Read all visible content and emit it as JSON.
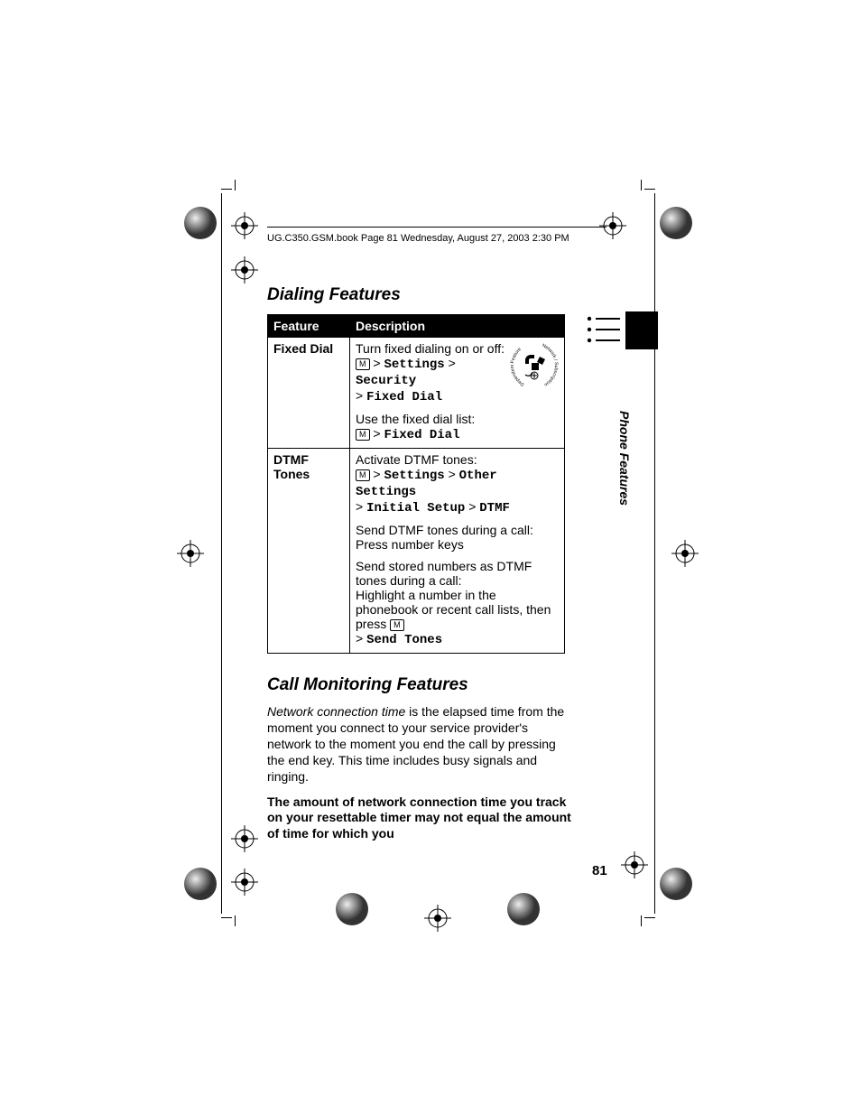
{
  "header": {
    "running": "UG.C350.GSM.book  Page 81  Wednesday, August 27, 2003  2:30 PM"
  },
  "section1": {
    "heading": "Dialing Features",
    "columns": {
      "feature": "Feature",
      "description": "Description"
    },
    "rows": {
      "fixed": {
        "name": "Fixed Dial",
        "p1": "Turn fixed dialing on or off:",
        "path1a": "Settings",
        "path1b": "Security",
        "path1c": "Fixed Dial",
        "p2": "Use the fixed dial list:",
        "path2a": "Fixed Dial",
        "icon_label": "Network / Subscription Dependent Feature"
      },
      "dtmf": {
        "name1": "DTMF",
        "name2": "Tones",
        "p1": "Activate DTMF tones:",
        "path1a": "Settings",
        "path1b": "Other Settings",
        "path1c": "Initial Setup",
        "path1d": "DTMF",
        "p2": "Send DTMF tones during a call:",
        "p2b": "Press number keys",
        "p3a": "Send stored numbers as DTMF tones during a call:",
        "p3b": "Highlight a number in the phonebook or recent call lists, then press ",
        "p3c": "Send Tones"
      }
    }
  },
  "section2": {
    "heading": "Call Monitoring Features",
    "para1_ital": "Network connection time",
    "para1_rest": " is the elapsed time from the moment you connect to your service provider's network to the moment you end the call by pressing the end key. This time includes busy signals and ringing.",
    "para2": "The amount of network connection time you track on your resettable timer may not equal the amount of time for which you"
  },
  "margin": {
    "side_label": "Phone Features",
    "page_number": "81"
  },
  "glyphs": {
    "menu_key": "M",
    "gt": ">"
  }
}
